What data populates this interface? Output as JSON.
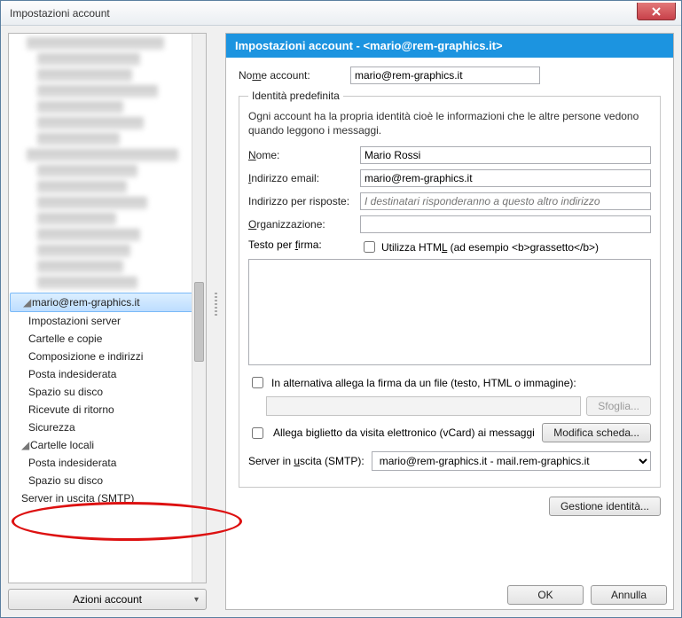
{
  "window": {
    "title": "Impostazioni account"
  },
  "sidebar": {
    "account": "mario@rem-graphics.it",
    "items": [
      "Impostazioni server",
      "Cartelle e copie",
      "Composizione e indirizzi",
      "Posta indesiderata",
      "Spazio su disco",
      "Ricevute di ritorno",
      "Sicurezza"
    ],
    "local_folders": "Cartelle locali",
    "local_items": [
      "Posta indesiderata",
      "Spazio su disco"
    ],
    "smtp": "Server in uscita (SMTP)",
    "actions": "Azioni account"
  },
  "header": {
    "title": "Impostazioni account - <mario@rem-graphics.it>"
  },
  "form": {
    "account_name_label": "Nome account:",
    "account_name": "mario@rem-graphics.it",
    "identity_legend": "Identità predefinita",
    "identity_desc": "Ogni account ha la propria identità cioè le informazioni che le altre persone vedono quando leggono i messaggi.",
    "name_label": "Nome:",
    "name": "Mario Rossi",
    "email_label": "Indirizzo email:",
    "email": "mario@rem-graphics.it",
    "reply_label": "Indirizzo per risposte:",
    "reply_placeholder": "I destinatari risponderanno a questo altro indirizzo",
    "org_label": "Organizzazione:",
    "sig_label": "Testo per firma:",
    "sig_html_cb": "Utilizza HTML (ad esempio <b>grassetto</b>)",
    "alt_file_cb": "In alternativa allega la firma da un file (testo, HTML o immagine):",
    "browse": "Sfoglia...",
    "vcard_cb": "Allega biglietto da visita elettronico (vCard) ai messaggi",
    "edit_card": "Modifica scheda...",
    "smtp_label": "Server in uscita (SMTP):",
    "smtp_value": "mario@rem-graphics.it - mail.rem-graphics.it",
    "manage_ident": "Gestione identità..."
  },
  "footer": {
    "ok": "OK",
    "cancel": "Annulla"
  }
}
